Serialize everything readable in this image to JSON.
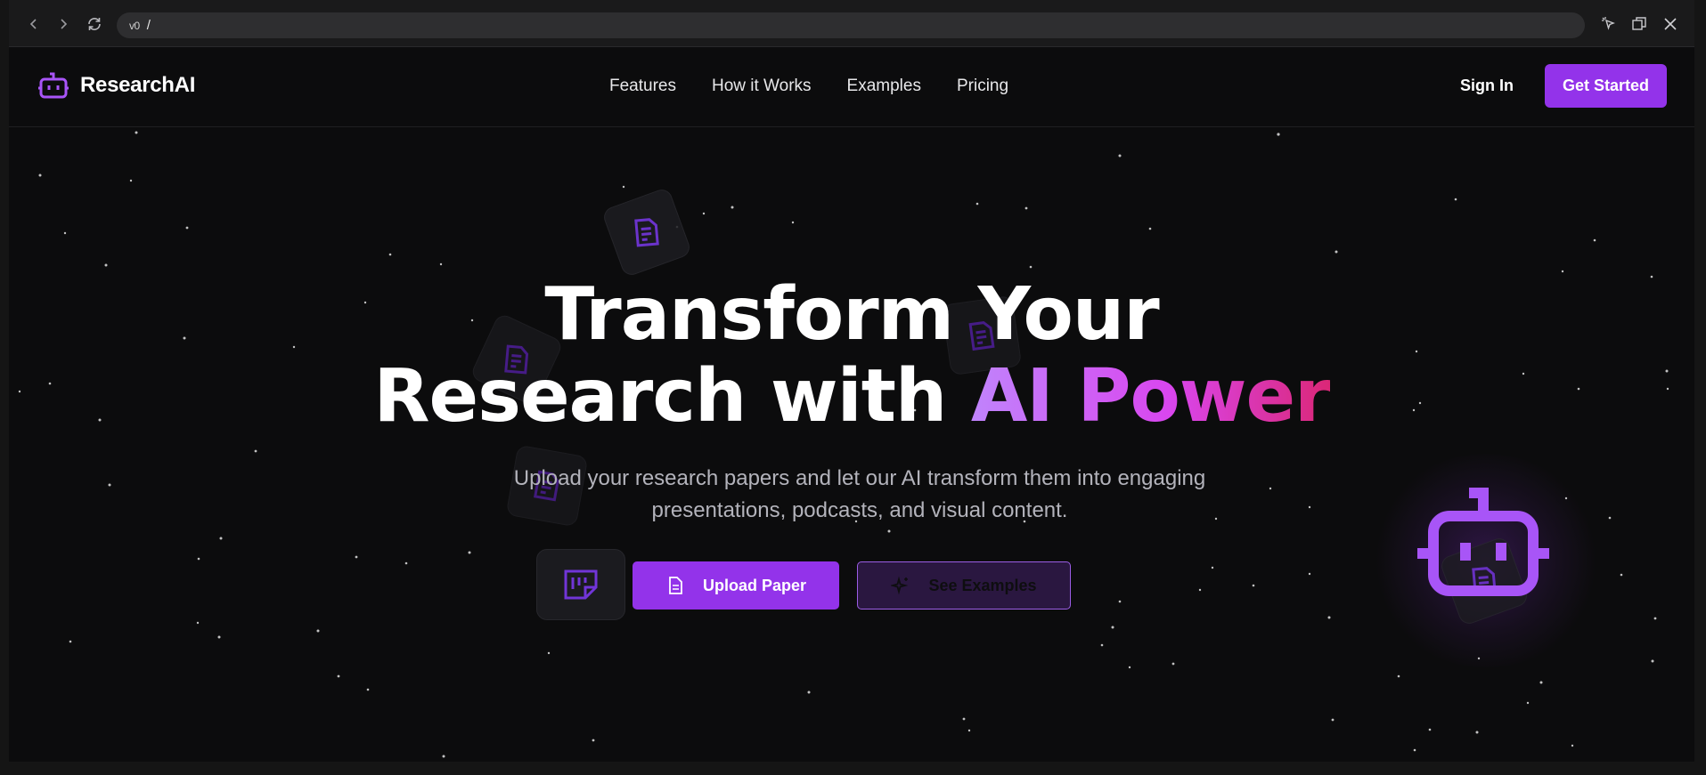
{
  "browser": {
    "url_prefix": "v0",
    "url_path": "/"
  },
  "header": {
    "brand": "ResearchAI",
    "nav": [
      "Features",
      "How it Works",
      "Examples",
      "Pricing"
    ],
    "sign_in": "Sign In",
    "cta": "Get Started"
  },
  "hero": {
    "title_line1": "Transform Your",
    "title_line2_plain": "Research with ",
    "title_line2_gradient": "AI Power",
    "subtitle": "Upload your research papers and let our AI transform them into engaging presentations, podcasts, and visual content.",
    "upload_label": "Upload Paper",
    "examples_label": "See Examples"
  },
  "colors": {
    "accent": "#9333ea",
    "background": "#0c0c0d",
    "gradient_start": "#c084fc",
    "gradient_end": "#db2777"
  },
  "icons": [
    "back-icon",
    "forward-icon",
    "reload-icon",
    "cursor-select-icon",
    "window-icon",
    "close-icon",
    "robot-logo-icon",
    "document-icon",
    "sparkle-icon"
  ]
}
